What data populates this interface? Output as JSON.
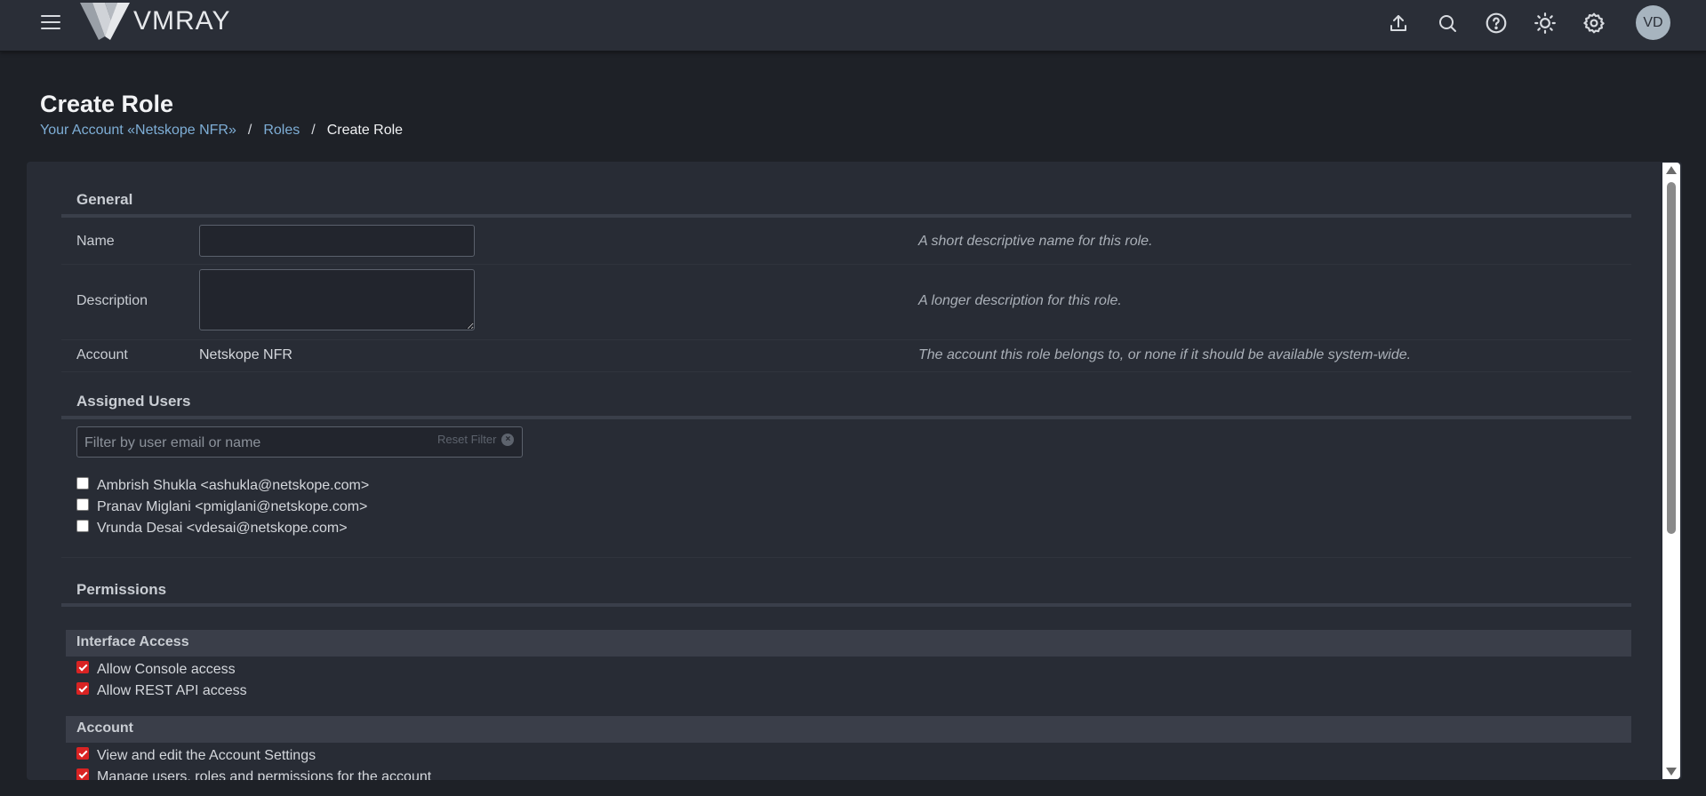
{
  "header": {
    "logo_text": "VMRAY",
    "avatar_initials": "VD",
    "icons": [
      "upload-icon",
      "search-icon",
      "help-icon",
      "theme-toggle-icon",
      "settings-icon"
    ]
  },
  "page": {
    "title": "Create Role",
    "breadcrumb": {
      "account": "Your Account «Netskope NFR»",
      "sep1": "/",
      "roles": "Roles",
      "sep2": "/",
      "current": "Create Role"
    }
  },
  "general": {
    "title": "General",
    "name_label": "Name",
    "name_hint": "A short descriptive name for this role.",
    "name_value": "",
    "description_label": "Description",
    "description_hint": "A longer description for this role.",
    "description_value": "",
    "account_label": "Account",
    "account_value": "Netskope NFR",
    "account_hint": "The account this role belongs to, or none if it should be available system-wide."
  },
  "assigned_users": {
    "title": "Assigned Users",
    "filter_placeholder": "Filter by user email or name",
    "reset_label": "Reset Filter",
    "users": [
      {
        "label": "Ambrish Shukla <ashukla@netskope.com>",
        "checked": false
      },
      {
        "label": "Pranav Miglani <pmiglani@netskope.com>",
        "checked": false
      },
      {
        "label": "Vrunda Desai <vdesai@netskope.com>",
        "checked": false
      }
    ]
  },
  "permissions": {
    "title": "Permissions",
    "groups": [
      {
        "title": "Interface Access",
        "items": [
          {
            "label": "Allow Console access",
            "checked": true
          },
          {
            "label": "Allow REST API access",
            "checked": true
          }
        ]
      },
      {
        "title": "Account",
        "items": [
          {
            "label": "View and edit the Account Settings",
            "checked": true
          },
          {
            "label": "Manage users, roles and permissions for the account",
            "checked": true
          }
        ]
      }
    ]
  },
  "colors": {
    "background": "#1e2127",
    "topbar": "#2a2e37",
    "panel": "#282c35",
    "link": "#7eaed6",
    "checkbox_on": "#d92323"
  }
}
